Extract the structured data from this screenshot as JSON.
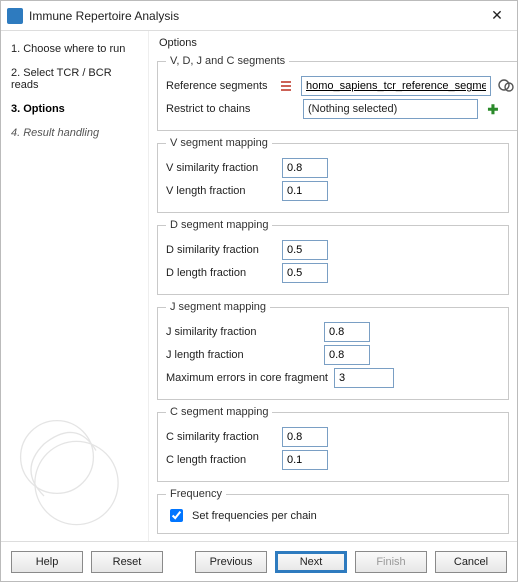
{
  "window": {
    "title": "Immune Repertoire Analysis"
  },
  "sidebar": {
    "steps": [
      {
        "label": "1.  Choose where to run"
      },
      {
        "label": "2.  Select TCR / BCR reads"
      },
      {
        "label": "3.  Options"
      },
      {
        "label": "4.  Result handling"
      }
    ]
  },
  "main": {
    "heading": "Options",
    "vdj": {
      "legend": "V, D, J and C segments",
      "reference_label": "Reference segments",
      "reference_value": "homo_sapiens_tcr_reference_segments",
      "restrict_label": "Restrict to chains",
      "restrict_value": "(Nothing selected)"
    },
    "vmap": {
      "legend": "V segment mapping",
      "sim_label": "V similarity fraction",
      "sim_value": "0.8",
      "len_label": "V length fraction",
      "len_value": "0.1"
    },
    "dmap": {
      "legend": "D segment mapping",
      "sim_label": "D similarity fraction",
      "sim_value": "0.5",
      "len_label": "D length fraction",
      "len_value": "0.5"
    },
    "jmap": {
      "legend": "J segment mapping",
      "sim_label": "J similarity fraction",
      "sim_value": "0.8",
      "len_label": "J length fraction",
      "len_value": "0.8",
      "max_label": "Maximum errors in core fragment",
      "max_value": "3"
    },
    "cmap": {
      "legend": "C segment mapping",
      "sim_label": "C similarity fraction",
      "sim_value": "0.8",
      "len_label": "C length fraction",
      "len_value": "0.1"
    },
    "freq": {
      "legend": "Frequency",
      "checkbox_label": "Set frequencies per chain",
      "checked": true
    }
  },
  "footer": {
    "help": "Help",
    "reset": "Reset",
    "previous": "Previous",
    "next": "Next",
    "finish": "Finish",
    "cancel": "Cancel"
  }
}
